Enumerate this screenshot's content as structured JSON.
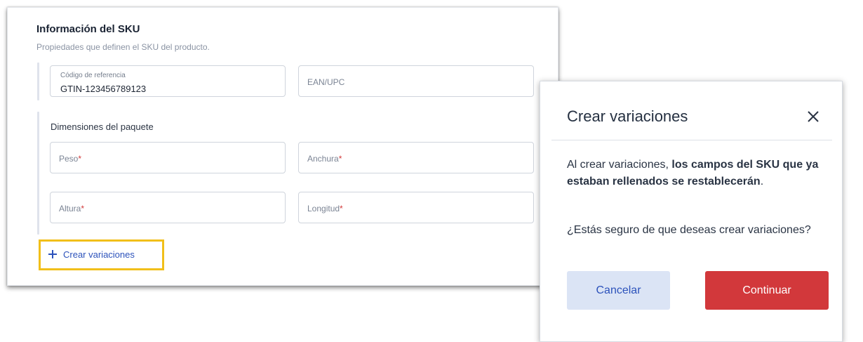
{
  "sku_card": {
    "title": "Información del SKU",
    "subtitle": "Propiedades que definen el SKU del producto.",
    "reference": {
      "label": "Código de referencia",
      "value": "GTIN-123456789123"
    },
    "ean_placeholder": "EAN/UPC",
    "dimensions_label": "Dimensiones del paquete",
    "fields": [
      {
        "label": "Peso",
        "required": "*"
      },
      {
        "label": "Anchura",
        "required": "*"
      },
      {
        "label": "Altura",
        "required": "*"
      },
      {
        "label": "Longitud",
        "required": "*"
      }
    ],
    "create_variations_link": "Crear variaciones"
  },
  "modal": {
    "title": "Crear variaciones",
    "body_intro": "Al crear variaciones, ",
    "body_bold": "los campos del SKU que ya estaban rellenados se restablecerán",
    "body_end": ".",
    "question": "¿Estás seguro de que deseas crear variaciones?",
    "cancel_label": "Cancelar",
    "continue_label": "Continuar"
  },
  "icons": {
    "add": "plus-icon",
    "close": "close-icon"
  },
  "colors": {
    "link": "#2c52bb",
    "highlight": "#f1bf1a",
    "continue": "#d2383b",
    "cancel_bg": "#dbe4f5",
    "required": "#d23a3a"
  }
}
